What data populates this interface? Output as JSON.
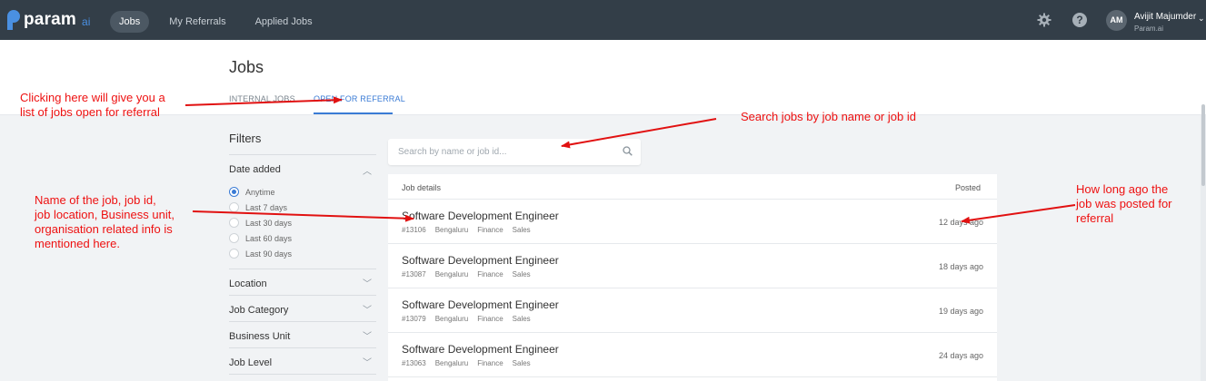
{
  "app": {
    "logo_text": "param",
    "logo_suffix": "ai",
    "nav": [
      {
        "label": "Jobs",
        "active": true
      },
      {
        "label": "My Referrals",
        "active": false
      },
      {
        "label": "Applied Jobs",
        "active": false
      }
    ],
    "help_glyph": "?",
    "user": {
      "initials": "AM",
      "name": "Avijit Majumder",
      "org": "Param.ai",
      "caret": "⌄"
    },
    "icons": [
      "gear-icon",
      "help-icon",
      "chevron-down-icon",
      "search-icon"
    ],
    "colors": {
      "topbar": "#333e48",
      "accent": "#3a7bd5",
      "annotation": "#e11111"
    }
  },
  "page": {
    "title": "Jobs",
    "tabs": [
      {
        "label": "INTERNAL JOBS",
        "active": false
      },
      {
        "label": "OPEN FOR REFERRAL",
        "active": true
      }
    ]
  },
  "filters": {
    "title": "Filters",
    "date_added": {
      "label": "Date added",
      "expanded_glyph": "︿",
      "options": [
        {
          "label": "Anytime",
          "checked": true
        },
        {
          "label": "Last 7 days",
          "checked": false
        },
        {
          "label": "Last 30 days",
          "checked": false
        },
        {
          "label": "Last 60 days",
          "checked": false
        },
        {
          "label": "Last 90 days",
          "checked": false
        }
      ]
    },
    "collapsed_glyph": "﹀",
    "sections": [
      "Location",
      "Job Category",
      "Business Unit",
      "Job Level"
    ]
  },
  "search": {
    "placeholder": "Search by name or job id..."
  },
  "jobs": {
    "header_left": "Job details",
    "header_right": "Posted",
    "rows": [
      {
        "title": "Software Development Engineer",
        "id": "#13106",
        "location": "Bengaluru",
        "business_unit": "Finance",
        "org": "Sales",
        "posted": "12 days ago"
      },
      {
        "title": "Software Development Engineer",
        "id": "#13087",
        "location": "Bengaluru",
        "business_unit": "Finance",
        "org": "Sales",
        "posted": "18 days ago"
      },
      {
        "title": "Software Development Engineer",
        "id": "#13079",
        "location": "Bengaluru",
        "business_unit": "Finance",
        "org": "Sales",
        "posted": "19 days ago"
      },
      {
        "title": "Software Development Engineer",
        "id": "#13063",
        "location": "Bengaluru",
        "business_unit": "Finance",
        "org": "Sales",
        "posted": "24 days ago"
      }
    ]
  },
  "annotations": {
    "referral_note": [
      "Clicking here will give you a",
      "list of jobs open for referral"
    ],
    "search_note": [
      "Search jobs by job name or job id"
    ],
    "details_note": [
      "Name of the job, job id,",
      "job location, Business unit,",
      "organisation related info is",
      "mentioned here."
    ],
    "posted_note": [
      "How long ago the",
      "job was posted for",
      "referral"
    ]
  }
}
